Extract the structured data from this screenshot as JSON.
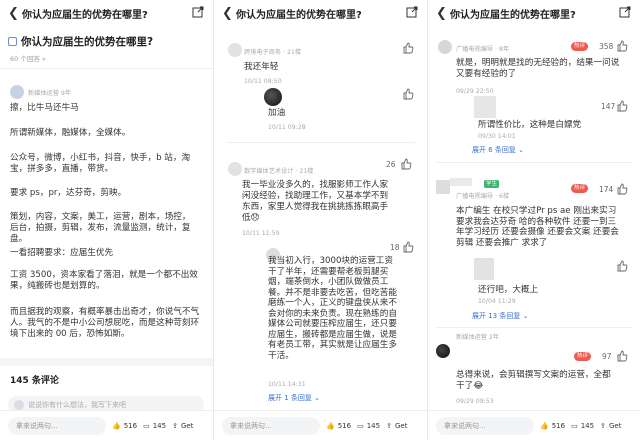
{
  "question_title": "你认为应届生的优势在哪里?",
  "panel1": {
    "question_title": "你认为应届生的优势在哪里?",
    "answer_count": "60 个回答 »",
    "author_meta": "新媒体运营 9年",
    "paragraphs": [
      "擦，比牛马还牛马",
      "所谓新媒体，融媒体，全媒体。",
      "公众号，微博，小红书，抖音，快手，b 站，淘宝，拼多多，直播，带货。",
      "要求 ps，pr，达芬奇，剪映。",
      "策划，内容，文案，美工，运营，剧本，场控，后台，拍摄，剪辑，发布，流量监测，统计，复盘。",
      "一看招聘要求：应届生优先",
      "工资 3500，资本家看了落泪，就是一个都不出效果，纯搬砖也是划算的。",
      "而且据我的观察，有概率暴击出奇才，你说气不气人。我气的不是中小公司想屁吃，而是这种苛刻环境下出来的 00 后，恐怖如斯。"
    ],
    "comments_heading": "145 条评论",
    "comment_placeholder": "说说你有什么想法，我写下来吧"
  },
  "panel2": {
    "question_title": "你认为应届生的优势在哪里?",
    "comments": [
      {
        "meta": "跨境电子商务 · 21楼",
        "text": "我还年轻",
        "time": "10/11 08:50",
        "likes": ""
      },
      {
        "meta": "",
        "text": "加油",
        "time": "10/11 09:28",
        "likes": ""
      },
      {
        "meta": "数字媒体艺术设计 · 21楼",
        "text": "我一毕业没多久的，找服影师工作人家闲没经验，找助理工作，又基本学不到东西，家里人觉得我在挑挑拣拣眼高手低😞",
        "time": "10/11 11:59",
        "likes": "26"
      },
      {
        "meta": "",
        "text": "我当初入行，3000块的运营工资干了半年，还需要帮老板剪腿买烟，端茶倒水，小团队做做员工餐。并不是非要去吃苦，但吃苦能磨练一个人，正义的键盘侠从来不会对你的未来负责。现在熟练的自媒体公司就要压榨应届生，还只要应届生，搬砖都是应届生做，说是有老员工带，其实就是让应届生多干活。",
        "time": "10/11 14:31",
        "likes": "18"
      }
    ],
    "expand_label": "展开 1 条回复 ⌄"
  },
  "panel3": {
    "question_title": "你认为应届生的优势在哪里?",
    "comments": [
      {
        "meta": "广播电视编导 · 8年",
        "badge": "热评",
        "text": "就是，明明就是找的无经验的，结果一问说又要有经验的了",
        "time": "09/29 22:50",
        "likes": "358"
      },
      {
        "meta": "",
        "text": "所谓性价比，这种是白嫖党",
        "time": "09/30 14:01",
        "likes": "147"
      },
      {
        "meta": "广播电视编导 · 6楼",
        "badge": "热评",
        "tag": "学生",
        "text": "本广编生 在校只学过Pr ps ae 刚出来实习要求我会达芬奇 哈的各种软件 还要一到三年学习经历 还要会摄像 还要会文案 还要会剪辑 还要会推广 求求了",
        "time": "",
        "likes": "174"
      },
      {
        "meta": "",
        "text": "还行吧，大概上",
        "time": "10/04 11:29",
        "likes": ""
      },
      {
        "meta": "新媒体运营 2年",
        "badge": "热评",
        "text": "总得来说，会剪辑撰写文案的运营，全都干了😂",
        "time": "09/29 09:53",
        "likes": "97"
      }
    ],
    "expand1": "展开 6 条回复 ⌄",
    "expand2": "展开 13 条回复 ⌄"
  },
  "bottom": {
    "input_placeholder": "拿来说两句...",
    "likes": "516",
    "comments": "145",
    "get_label": "Get"
  },
  "colors": {
    "accent": "#3b6fd6",
    "hot_badge": "#ef5a4f",
    "student_badge": "#3cb371"
  }
}
